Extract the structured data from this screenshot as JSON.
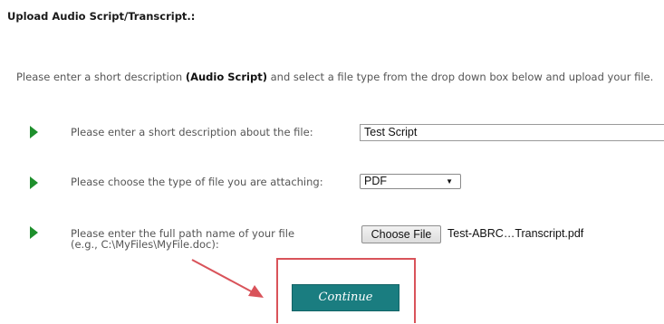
{
  "page": {
    "title": "Upload Audio Script/Transcript.:"
  },
  "intro": {
    "before": "Please enter a short description ",
    "bold": "(Audio Script)",
    "after": " and select a file type from the drop down box below and upload your file."
  },
  "form": {
    "description": {
      "label": "Please enter a short description about the file:",
      "value": "Test Script"
    },
    "file_type": {
      "label": "Please choose the type of file you are attaching:",
      "selected": "PDF"
    },
    "file_path": {
      "label_line1": "Please enter the full path name of your file",
      "label_line2": "(e.g., C:\\MyFiles\\MyFile.doc):",
      "button_label": "Choose File",
      "file_name": "Test-ABRC…Transcript.pdf"
    },
    "continue_label": "Continue"
  },
  "icons": {
    "row_bullet": "play-triangle-icon",
    "annotation": "red-arrow-pointer"
  },
  "colors": {
    "bullet_green": "#1e8f2c",
    "continue_teal": "#1a7d80",
    "annotation_red": "#d9535a"
  }
}
